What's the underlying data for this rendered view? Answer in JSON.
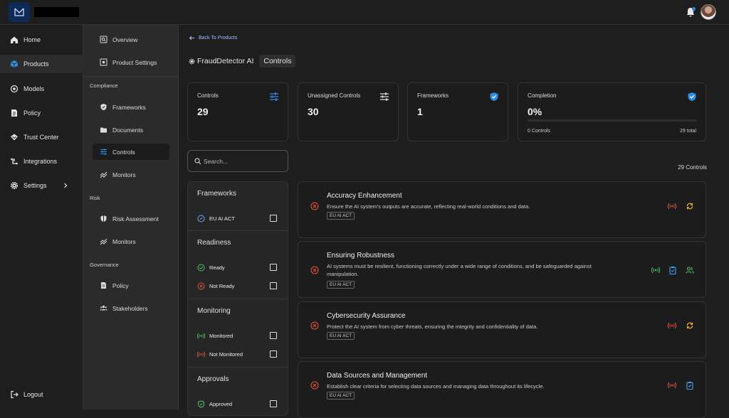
{
  "topbar": {
    "logo_icon": "mail-logo-icon",
    "bell_icon": "bell-icon",
    "accent": "#1e88e5"
  },
  "sidebar": {
    "items": [
      {
        "label": "Home",
        "icon": "home-icon"
      },
      {
        "label": "Products",
        "icon": "products-icon"
      },
      {
        "label": "Models",
        "icon": "models-icon"
      },
      {
        "label": "Policy",
        "icon": "policy-icon"
      },
      {
        "label": "Trust Center",
        "icon": "trust-center-icon"
      },
      {
        "label": "Integrations",
        "icon": "integrations-icon"
      },
      {
        "label": "Settings",
        "icon": "gear-icon"
      }
    ],
    "logout": "Logout"
  },
  "subnav": {
    "overview": "Overview",
    "product_settings": "Product Settings",
    "compliance_heading": "Compliance",
    "frameworks": "Frameworks",
    "documents": "Documents",
    "controls": "Controls",
    "monitors": "Monitors",
    "risk_heading": "Risk",
    "risk_assessment": "Risk Assessment",
    "risk_monitors": "Monitors",
    "governance_heading": "Governance",
    "policy": "Policy",
    "stakeholders": "Stakeholders"
  },
  "main": {
    "back_label": "Back To Products",
    "product_name": "FraudDetector AI",
    "current_tab": "Controls",
    "cards": {
      "controls": {
        "title": "Controls",
        "value": "29"
      },
      "unassigned": {
        "title": "Unassigned Controls",
        "value": "30"
      },
      "frameworks": {
        "title": "Frameworks",
        "value": "1"
      },
      "completion": {
        "title": "Completion",
        "value": "0%",
        "progress": 0,
        "foot_left": "0 Controls",
        "foot_right": "29 total"
      }
    },
    "search_placeholder": "Search...",
    "control_count": "29 Controls"
  },
  "filters": {
    "frameworks": {
      "heading": "Frameworks",
      "items": [
        "EU AI ACT"
      ]
    },
    "readiness": {
      "heading": "Readiness",
      "items": [
        "Ready",
        "Not Ready"
      ]
    },
    "monitoring": {
      "heading": "Monitoring",
      "items": [
        "Monitored",
        "Not Monitored"
      ]
    },
    "approvals": {
      "heading": "Approvals",
      "items": [
        "Approved"
      ]
    }
  },
  "controls": [
    {
      "name": "Accuracy Enhancement",
      "description": "Ensure the AI system's outputs are accurate, reflecting real-world conditions and data.",
      "tag": "EU AI ACT"
    },
    {
      "name": "Ensuring Robustness",
      "description": "AI systems must be resilient, functioning correctly under a wide range of conditions, and be safeguarded against manipulation.",
      "tag": "EU AI ACT"
    },
    {
      "name": "Cybersecurity Assurance",
      "description": "Protect the AI system from cyber threats, ensuring the integrity and confidentiality of data.",
      "tag": "EU AI ACT"
    },
    {
      "name": "Data Sources and Management",
      "description": "Establish clear criteria for selecting data sources and managing data throughout its lifecycle.",
      "tag": "EU AI ACT"
    }
  ]
}
